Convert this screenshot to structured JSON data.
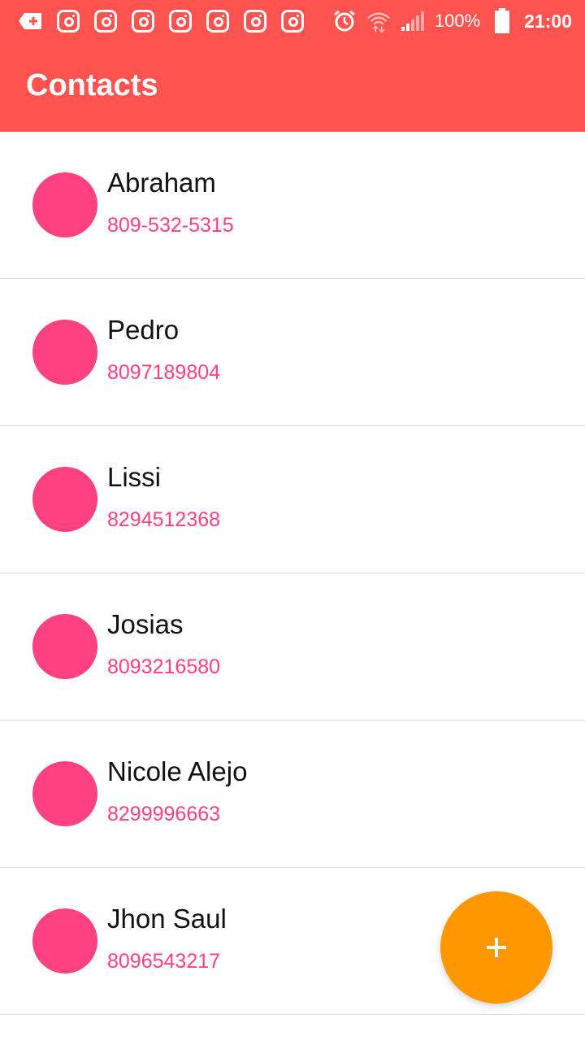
{
  "status_bar": {
    "battery_percent": "100%",
    "time": "21:00",
    "notification_icons": [
      "add-to-queue-icon",
      "instagram-icon",
      "instagram-icon",
      "instagram-icon",
      "instagram-icon",
      "instagram-icon",
      "instagram-icon",
      "instagram-icon"
    ],
    "system_icons": [
      "alarm-icon",
      "wifi-icon",
      "cellular-signal-icon",
      "battery-icon"
    ]
  },
  "app_bar": {
    "title": "Contacts"
  },
  "contacts": [
    {
      "name": "Abraham",
      "phone": "809-532-5315"
    },
    {
      "name": "Pedro",
      "phone": "8097189804"
    },
    {
      "name": "Lissi",
      "phone": "8294512368"
    },
    {
      "name": "Josias",
      "phone": "8093216580"
    },
    {
      "name": "Nicole Alejo",
      "phone": "8299996663"
    },
    {
      "name": "Jhon Saul",
      "phone": "8096543217"
    }
  ],
  "fab": {
    "icon": "plus-icon",
    "color": "#ff9800"
  },
  "colors": {
    "primary": "#ff5350",
    "accent": "#ff4081",
    "fab": "#ff9800"
  }
}
